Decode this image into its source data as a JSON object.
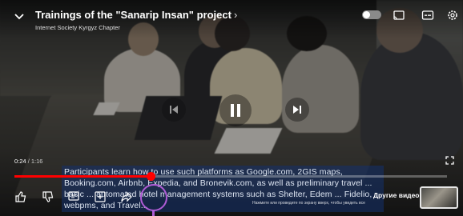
{
  "video": {
    "title": "Trainings of the \"Sanarip Insan\" project",
    "channel": "Internet Society Kyrgyz Chapter",
    "current_time": "0:24",
    "duration": "1:16",
    "progress_fraction": 0.316,
    "caption": "Participants learn how to use such platforms as Google.com, 2GIS maps, Booking.com, Airbnb, Expedia, and Bronevik.com, as well as preliminary travel ... basic ... automated hotel management systems such as Shelter, Edem ... Fidelio, webpms, and Travel..."
  },
  "bottom": {
    "other_videos_label": "Другие видео",
    "other_videos_hint": "Нажмите или проведите по экрану вверх, чтобы увидеть все"
  },
  "icons": {
    "collapse": "chevron-down-icon",
    "autoplay": "autoplay-toggle-icon",
    "cast": "cast-icon",
    "captions": "captions-icon",
    "settings": "gear-icon",
    "previous": "skip-previous-icon",
    "pause": "pause-icon",
    "next": "skip-next-icon",
    "fullscreen": "fullscreen-icon",
    "like": "thumbs-up-icon",
    "dislike": "thumbs-down-icon",
    "comments": "comment-icon",
    "save": "save-to-playlist-icon",
    "share": "share-icon",
    "more": "more-icon"
  },
  "colors": {
    "progress": "#ff0000",
    "highlight_ring": "#b05cd6",
    "caption_bg": "#14326e"
  }
}
